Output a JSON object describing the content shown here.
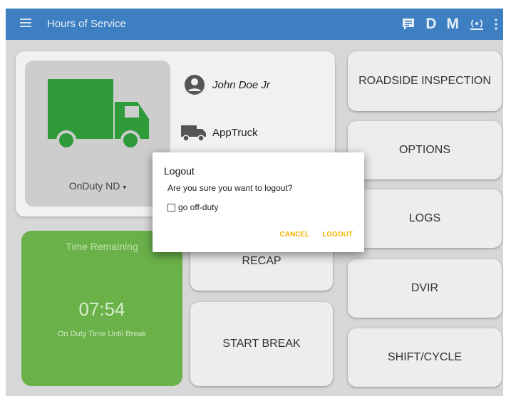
{
  "app_bar": {
    "title": "Hours of Service",
    "letters": [
      "D",
      "M"
    ],
    "icons": [
      "menu-icon",
      "message-icon",
      "eld-connection-icon",
      "more-vert-icon"
    ],
    "color": "#3d7fc1"
  },
  "status": {
    "label": "OnDuty ND",
    "truck_color": "#2e9a3a"
  },
  "driver": {
    "name": "John Doe Jr"
  },
  "vehicle": {
    "name": "AppTruck"
  },
  "timer": {
    "heading": "Time Remaining",
    "value": "07:54",
    "caption": "On Duty Time Until Break",
    "color": "#6ab14a"
  },
  "middle_buttons": {
    "recap": "RECAP",
    "start_break": "START BREAK"
  },
  "right_buttons": {
    "roadside": "ROADSIDE INSPECTION",
    "options": "OPTIONS",
    "logs": "LOGS",
    "dvir": "DVIR",
    "shift_cycle": "SHIFT/CYCLE"
  },
  "dialog": {
    "title": "Logout",
    "message": "Are you sure you want to logout?",
    "checkbox_label": "go off-duty",
    "checkbox_checked": false,
    "cancel": "CANCEL",
    "logout": "LOGOUT",
    "accent": "#f4b400"
  }
}
